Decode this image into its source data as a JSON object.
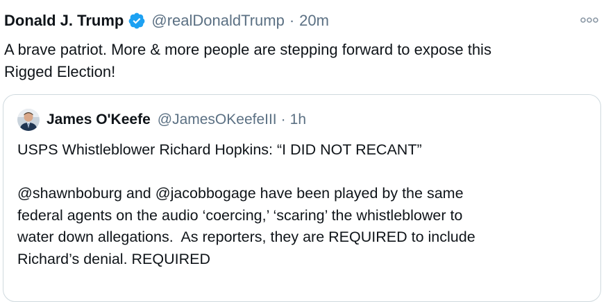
{
  "tweet": {
    "display_name": "Donald J. Trump",
    "handle": "@realDonaldTrump",
    "separator": "·",
    "time": "20m",
    "text": "A brave patriot. More & more people are stepping forward to expose this\nRigged Election!",
    "verified_color": "#1da1f2",
    "more_icon": "more-dots-icon"
  },
  "quote": {
    "display_name": "James O'Keefe",
    "handle": "@JamesOKeefeIII",
    "separator": "·",
    "time": "1h",
    "text": "USPS Whistleblower Richard Hopkins: “I DID NOT RECANT”\n\n@shawnboburg and @jacobbogage have been played by the same\nfederal agents on the audio ‘coercing,’ ‘scaring’ the whistleblower to\nwater down allegations.  As reporters, they are REQUIRED to include\nRichard’s denial. REQUIRED"
  },
  "colors": {
    "text_primary": "#0f1419",
    "text_secondary": "#5b7083",
    "border": "#cfd9de"
  }
}
